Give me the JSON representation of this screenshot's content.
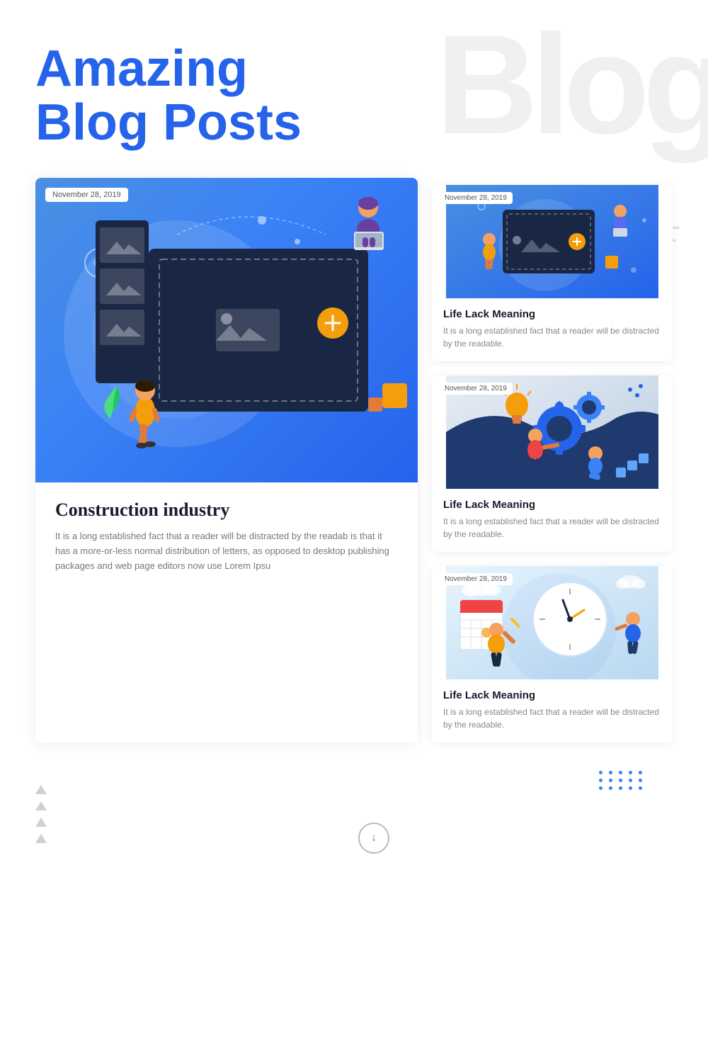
{
  "hero": {
    "title_line1": "Amazing",
    "title_line2": "Blog Posts",
    "watermark": "Blog"
  },
  "main_post": {
    "date": "November 28, 2019",
    "title": "Construction industry",
    "excerpt": "It is a long established fact that a reader will be distracted by the readab is that it has a more-or-less normal distribution of letters, as opposed to desktop publishing packages and web page editors now use Lorem Ipsu"
  },
  "sidebar_posts": [
    {
      "date": "November 28, 2019",
      "title": "Life Lack Meaning",
      "excerpt": "It is a long established fact that a reader will be distracted by the readable."
    },
    {
      "date": "November 28, 2019",
      "title": "Life Lack Meaning",
      "excerpt": "It is a long established fact that a reader will be distracted by the readable."
    },
    {
      "date": "November 28, 2019",
      "title": "Life Lack Meaning",
      "excerpt": "It is a long established fact that a reader will be distracted by the readable."
    }
  ],
  "colors": {
    "primary_blue": "#2563eb",
    "accent_orange": "#f59e0b",
    "text_dark": "#1a1a2e",
    "text_gray": "#777",
    "bg_white": "#ffffff"
  },
  "scroll_button_label": "↓"
}
